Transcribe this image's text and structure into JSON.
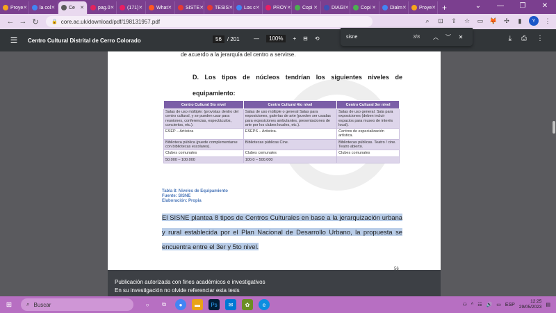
{
  "tabs": [
    {
      "label": "Proye",
      "color": "#f6a61b"
    },
    {
      "label": "la col",
      "color": "#4285f4"
    },
    {
      "label": "Ce",
      "color": "#5b5b5b",
      "active": true
    },
    {
      "label": "pag.0",
      "color": "#e0245e"
    },
    {
      "label": "(171)",
      "color": "#e91e63"
    },
    {
      "label": "What",
      "color": "#ff5722"
    },
    {
      "label": "SISTE",
      "color": "#e53935"
    },
    {
      "label": "TESIS",
      "color": "#e53935"
    },
    {
      "label": "Los c",
      "color": "#4285f4"
    },
    {
      "label": "PROY",
      "color": "#e91e63"
    },
    {
      "label": "Copi",
      "color": "#4caf50"
    },
    {
      "label": "DIAGI",
      "color": "#3f51b5"
    },
    {
      "label": "Copi",
      "color": "#4caf50"
    },
    {
      "label": "Dialm",
      "color": "#4285f4"
    },
    {
      "label": "Proye",
      "color": "#f6a61b"
    }
  ],
  "address": {
    "url": "core.ac.uk/download/pdf/198131957.pdf",
    "avatar": "Y"
  },
  "find": {
    "query": "sisne",
    "count": "3/8"
  },
  "pdf": {
    "title": "Centro Cultural Distrital de Cerro Colorado",
    "page": "56",
    "total": "/ 201",
    "zoom": "100%"
  },
  "doc": {
    "prev_line": "de acuerdo a la jerarquía del centro a servirse.",
    "heading": "D. Los tipos de núcleos tendrían los siguientes niveles de equipamiento:",
    "table": {
      "headers": [
        "Centro Cultural 5to nivel",
        "Centro Cultural 4to nivel",
        "Centro Cultural 3er nivel"
      ],
      "rows": [
        [
          "Salas de uso múltiple: (provistas dentro del centro cultural, y se pueden usar para reuniones, conferencias, espectáculos, conciertos, etc.).",
          "Salas de uso múltiple o general Salas para exposiciones, galerías de arte (pueden ser usadas para exposiciones ambulantes, presentaciones de arte por los clubes locales, etc.).",
          "Salas de uso general. Sala para exposiciones (deben incluir espacios para museo de interés local)."
        ],
        [
          "ESEP – Artística",
          "ESEPS – Artística.",
          "Centros de especialización artística."
        ],
        [
          "Biblioteca pública (puede complementarse con bibliotecas escolares).",
          "Bibliotecas públicas Cine.",
          "Bibliotecas públicas. Teatro / cine. Teatro abierto."
        ],
        [
          "Clubes comunales",
          "Clubes comunales",
          "Clubes comunales"
        ],
        [
          "50.000 – 100.000",
          "100.0     – 500.000",
          ""
        ]
      ]
    },
    "caption": [
      "Tabla 8: Niveles de Equipamiento",
      "Fuente: SISNE",
      "Elaboración: Propia"
    ],
    "paragraph": "El SISNE plantea 8 tipos de Centros Culturales en base a la jerarquización urbana y rural establecida por el Plan Nacional de Desarrollo Urbano, la propuesta se encuentra entre el 3er y 5to nivel.",
    "page_number": "56",
    "banner": [
      "Publicación autorizada con fines académicos e investigativos",
      "En su investigación no olvide referenciar esta tesis"
    ]
  },
  "taskbar": {
    "search": "Buscar",
    "lang": "ESP",
    "time": "12:25",
    "date": "29/05/2023"
  }
}
